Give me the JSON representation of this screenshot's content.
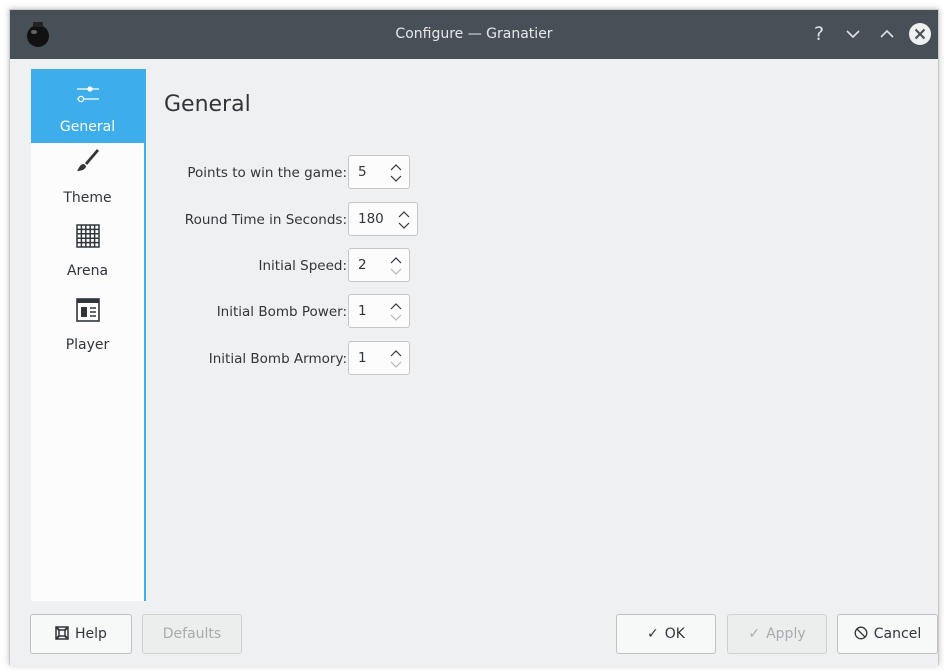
{
  "window": {
    "title": "Configure — Granatier",
    "titlebar_buttons": {
      "help": "?",
      "minimize": "chevron-down",
      "maximize": "chevron-up",
      "close": "close"
    }
  },
  "sidebar": {
    "items": [
      {
        "label": "General",
        "icon": "sliders-icon",
        "active": true
      },
      {
        "label": "Theme",
        "icon": "brush-icon",
        "active": false
      },
      {
        "label": "Arena",
        "icon": "grid-icon",
        "active": false
      },
      {
        "label": "Player",
        "icon": "player-form-icon",
        "active": false
      }
    ]
  },
  "page": {
    "title": "General",
    "fields": [
      {
        "label": "Points to win the game:",
        "value": "5"
      },
      {
        "label": "Round Time in Seconds:",
        "value": "180"
      },
      {
        "label": "Initial Speed:",
        "value": "2"
      },
      {
        "label": "Initial Bomb Power:",
        "value": "1"
      },
      {
        "label": "Initial Bomb Armory:",
        "value": "1"
      }
    ]
  },
  "buttons": {
    "help": "Help",
    "defaults": "Defaults",
    "ok": "OK",
    "apply": "Apply",
    "cancel": "Cancel"
  },
  "colors": {
    "accent": "#3daee9",
    "titlebar": "#475057",
    "background": "#eff0f1"
  }
}
